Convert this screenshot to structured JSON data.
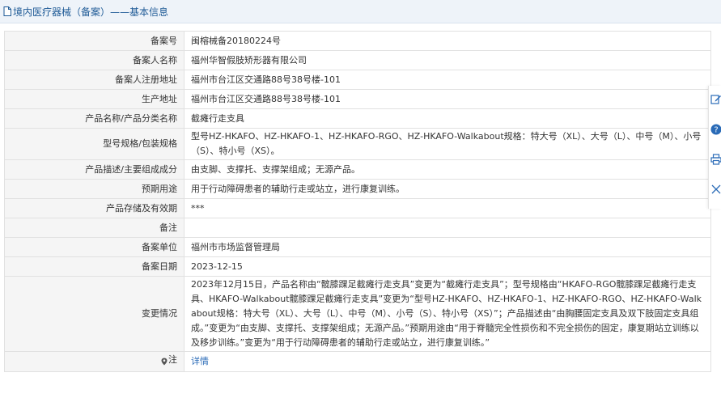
{
  "header": {
    "title": "境内医疗器械（备案）——基本信息",
    "icon": "document-icon",
    "background": "#eef3f9",
    "title_color": "#1e5a96"
  },
  "rows": [
    {
      "label": "备案号",
      "value": "闽榕械备20180224号"
    },
    {
      "label": "备案人名称",
      "value": "福州华智假肢矫形器有限公司"
    },
    {
      "label": "备案人注册地址",
      "value": "福州市台江区交通路88号38号楼-101"
    },
    {
      "label": "生产地址",
      "value": "福州市台江区交通路88号38号楼-101"
    },
    {
      "label": "产品名称/产品分类名称",
      "value": "截瘫行走支具"
    },
    {
      "label": "型号规格/包装规格",
      "value": "型号HZ-HKAFO、HZ-HKAFO-1、HZ-HKAFO-RGO、HZ-HKAFO-Walkabout规格：特大号（XL）、大号（L）、中号（M）、小号（S）、特小号（XS）。"
    },
    {
      "label": "产品描述/主要组成成分",
      "value": "由支脚、支撑托、支撑架组成；无源产品。"
    },
    {
      "label": "预期用途",
      "value": "用于行动障碍患者的辅助行走或站立，进行康复训练。"
    },
    {
      "label": "产品存储及有效期",
      "value": "***"
    },
    {
      "label": "备注",
      "value": ""
    },
    {
      "label": "备案单位",
      "value": "福州市市场监督管理局"
    },
    {
      "label": "备案日期",
      "value": "2023-12-15"
    },
    {
      "label": "变更情况",
      "value": "2023年12月15日，产品名称由“髋膝踝足截瘫行走支具”变更为“截瘫行走支具”；型号规格由“HKAFO-RGO髋膝踝足截瘫行走支具、HKAFO-Walkabout髋膝踝足截瘫行走支具”变更为“型号HZ-HKAFO、HZ-HKAFO-1、HZ-HKAFO-RGO、HZ-HKAFO-Walkabout规格：特大号（XL）、大号（L）、中号（M）、小号（S）、特小号（XS）”；产品描述由“由胸腰固定支具及双下肢固定支具组成。”变更为“由支脚、支撑托、支撑架组成；无源产品。”预期用途由“用于脊髓完全性损伤和不完全损伤的固定，康复期站立训练以及移步训练。”变更为“用于行动障碍患者的辅助行走或站立，进行康复训练。”"
    }
  ],
  "note_row": {
    "label": "注",
    "icon": "location-pin-icon",
    "link": "详情"
  },
  "side_tools": [
    "edit-icon",
    "help-icon",
    "print-icon",
    "close-icon"
  ],
  "colors": {
    "label_bg": "#f5f5f5",
    "border": "#e1e1e1",
    "link": "#2a6bb7"
  }
}
